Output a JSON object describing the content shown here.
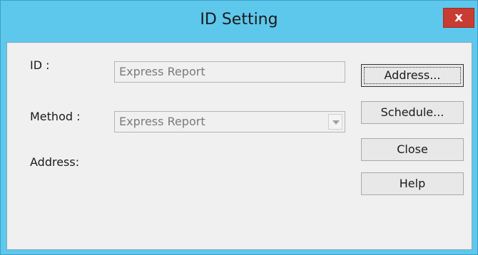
{
  "window": {
    "title": "ID Setting",
    "close_glyph": "x"
  },
  "form": {
    "id_label": "ID :",
    "id_value": "Express Report",
    "method_label": "Method :",
    "method_value": "Express Report",
    "address_label": "Address:"
  },
  "buttons": {
    "address": "Address...",
    "schedule": "Schedule...",
    "close": "Close",
    "help": "Help"
  },
  "colors": {
    "titlebar": "#5ec8ec",
    "close_button": "#c83c32",
    "client": "#f0f0f0"
  },
  "icons": {
    "dropdown": "chevron-down-icon",
    "close": "close-icon"
  }
}
